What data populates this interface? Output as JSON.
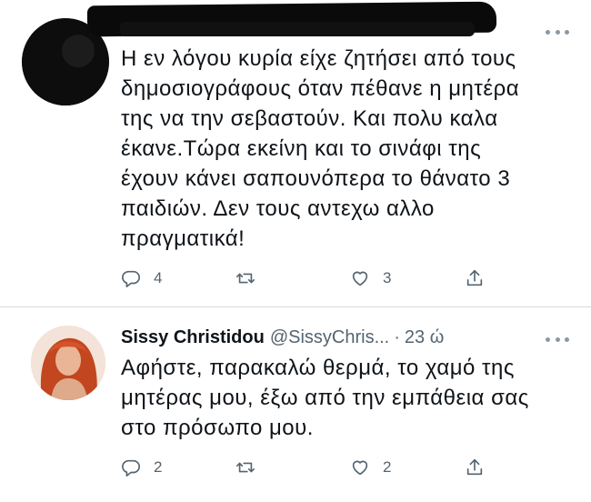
{
  "tweets": [
    {
      "author_name": "",
      "handle": "",
      "text": "Η εν λόγου κυρία είχε ζητήσει από τους\nδημοσιογράφους όταν πέθανε η μητέρα\nτης να την σεβαστούν. Και πολυ καλα\nέκανε.Τώρα εκείνη και το σινάφι της\nέχουν κάνει σαπουνόπερα το θάνατο 3\nπαιδιών. Δεν τους αντεχω αλλο\nπραγματικά!",
      "replies": "4",
      "retweets": "",
      "likes": "3",
      "name_redacted": true
    },
    {
      "author_name": "Sissy Christidou",
      "handle": "@SissyChris...",
      "separator": "·",
      "time": "23 ώ",
      "text": "Αφήστε, παρακαλώ θερμά, το χαμό της\nμητέρας μου, έξω από την εμπάθεια σας\nστο πρόσωπο μου.",
      "replies": "2",
      "retweets": "",
      "likes": "2"
    }
  ],
  "icons": {
    "reply": "reply-icon",
    "retweet": "retweet-icon",
    "like": "heart-icon",
    "share": "share-icon",
    "more": "more-options-icon"
  },
  "colors": {
    "text": "#0f1419",
    "secondary": "#536471",
    "divider": "#d9d9d9",
    "background": "#ffffff"
  }
}
